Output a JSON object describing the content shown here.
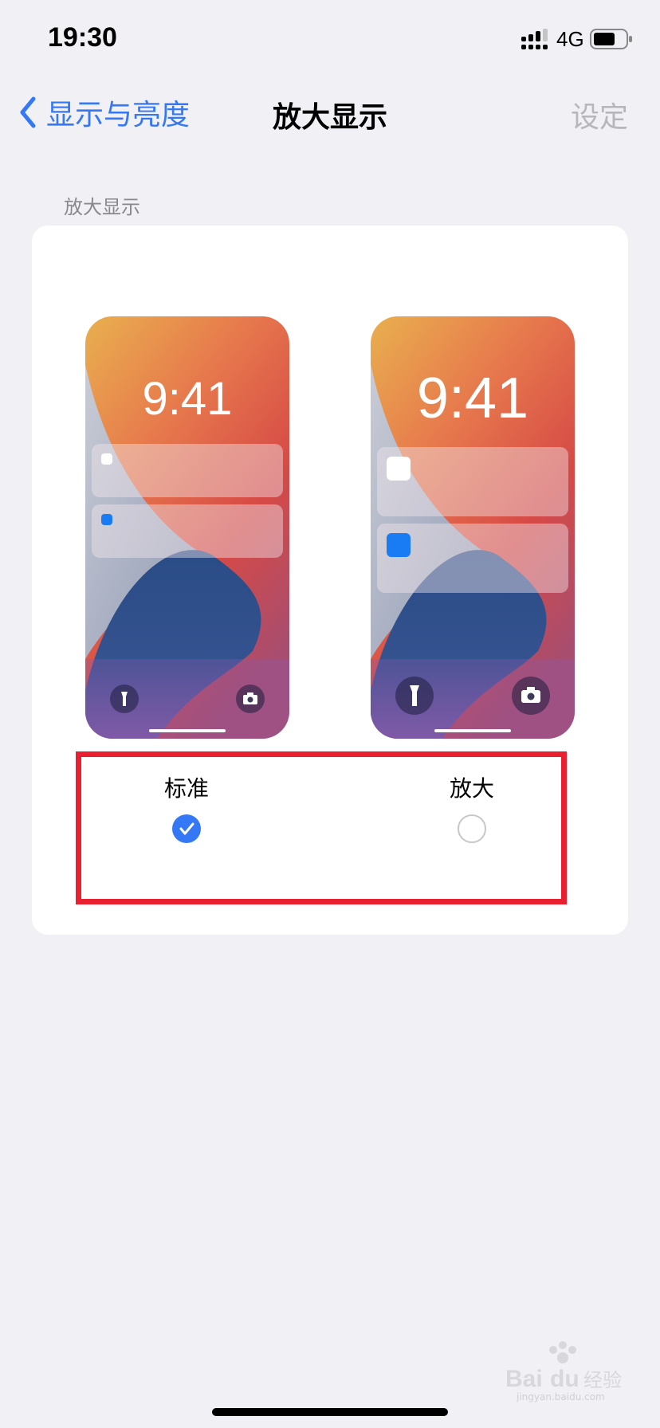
{
  "status_bar": {
    "time": "19:30",
    "network": "4G"
  },
  "nav": {
    "back_label": "显示与亮度",
    "title": "放大显示",
    "settings_label": "设定"
  },
  "section": {
    "header": "放大显示"
  },
  "previews": [
    {
      "lock_time": "9:41",
      "notification_icon_colors": [
        "#ffffff",
        "#1a7cf5"
      ]
    },
    {
      "lock_time": "9:41",
      "notification_icon_colors": [
        "#ffffff",
        "#1a7cf5"
      ]
    }
  ],
  "options": [
    {
      "label": "标准",
      "selected": true
    },
    {
      "label": "放大",
      "selected": false
    }
  ],
  "colors": {
    "accent": "#3478f6",
    "highlight": "#e8202f",
    "background": "#f0f0f5"
  },
  "watermark": {
    "text": "jingyan.baidu.com"
  }
}
